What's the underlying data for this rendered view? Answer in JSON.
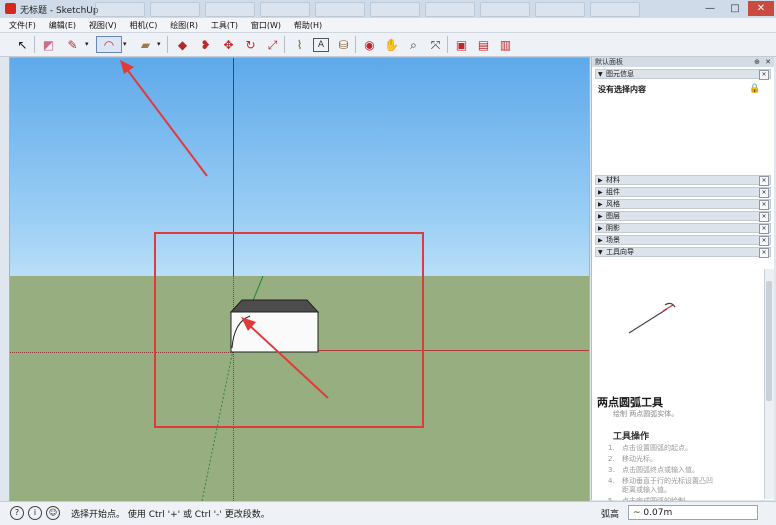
{
  "window": {
    "title": "无标题 - SketchUp",
    "controls": {
      "minimize": "—",
      "maximize": "□",
      "close": "✕"
    }
  },
  "menu": [
    "文件(F)",
    "编辑(E)",
    "视图(V)",
    "相机(C)",
    "绘图(R)",
    "工具(T)",
    "窗口(W)",
    "帮助(H)"
  ],
  "toolbar": {
    "tools": [
      {
        "name": "select-tool",
        "glyph": "↖"
      },
      {
        "name": "eraser-tool",
        "glyph": "◩"
      },
      {
        "name": "pencil-tool",
        "glyph": "✎"
      },
      {
        "name": "pencil-dropdown",
        "glyph": "▾"
      },
      {
        "name": "arc-tool",
        "glyph": "◠"
      },
      {
        "name": "arc-dropdown",
        "glyph": "▾"
      },
      {
        "name": "shape-tool",
        "glyph": "▰"
      },
      {
        "name": "shape-dropdown",
        "glyph": "▾"
      },
      {
        "name": "push-pull-tool",
        "glyph": "◆"
      },
      {
        "name": "follow-me-tool",
        "glyph": "❥"
      },
      {
        "name": "move-tool",
        "glyph": "✥"
      },
      {
        "name": "rotate-tool",
        "glyph": "↻"
      },
      {
        "name": "scale-tool",
        "glyph": "⤢"
      },
      {
        "name": "tape-measure-tool",
        "glyph": "⌇"
      },
      {
        "name": "text-tool",
        "glyph": "A"
      },
      {
        "name": "paint-bucket-tool",
        "glyph": "⛁"
      },
      {
        "name": "orbit-tool",
        "glyph": "◉"
      },
      {
        "name": "pan-tool",
        "glyph": "✋"
      },
      {
        "name": "zoom-tool",
        "glyph": "⌕"
      },
      {
        "name": "zoom-extents-tool",
        "glyph": "⤧"
      },
      {
        "name": "warehouse-tool",
        "glyph": "▣"
      },
      {
        "name": "extension-warehouse-tool",
        "glyph": "▤"
      },
      {
        "name": "share-model-tool",
        "glyph": "▥"
      }
    ]
  },
  "panel": {
    "title": "默认面板",
    "pin": "⊕",
    "close": "✕",
    "entity_info": {
      "label": "图元信息",
      "no_selection": "没有选择内容"
    },
    "sections": [
      "材料",
      "组件",
      "风格",
      "图层",
      "阴影",
      "场景"
    ],
    "instructor": {
      "label": "工具向导",
      "tool_name": "两点圆弧工具",
      "tool_desc": "绘制 两点圆弧实体。",
      "ops_title": "工具操作",
      "steps": [
        "点击设置圆弧的起点。",
        "移动光标。",
        "点击圆弧终点或输入值。",
        "移动垂直于行的光标设置凸凹",
        "距离或输入值。",
        "点击完成圆弧的绘制。"
      ],
      "step_numbers": [
        "1.",
        "2.",
        "3.",
        "4.",
        "",
        "5."
      ]
    }
  },
  "status": {
    "text": "选择开始点。 使用 Ctrl '+' 或 Ctrl '-' 更改段数。",
    "measure_label": "弧高",
    "measure_value": "~ 0.07m"
  },
  "colors": {
    "annotation_red": "#e23a3a",
    "sky_top": "#5ea9ea",
    "ground": "#97ae80"
  }
}
